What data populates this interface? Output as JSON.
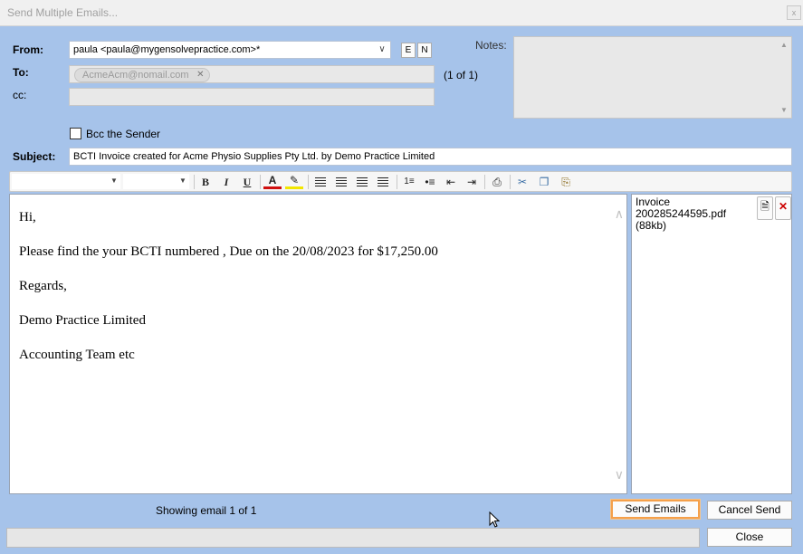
{
  "window": {
    "title": "Send Multiple Emails...",
    "close_glyph": "x"
  },
  "form": {
    "from_label": "From:",
    "from_value": "paula <paula@mygensolvepractice.com>*",
    "e_button": "E",
    "n_button": "N",
    "to_label": "To:",
    "to_chip": "AcmeAcm@nomail.com",
    "to_count": "(1 of 1)",
    "cc_label": "cc:",
    "cc_value": "",
    "notes_label": "Notes:",
    "notes_value": "",
    "bcc_label": "Bcc the Sender",
    "bcc_checked": false,
    "subject_label": "Subject:",
    "subject_value": "BCTI Invoice created for  Acme Physio Supplies Pty Ltd. by  Demo Practice Limited"
  },
  "toolbar": {
    "font_value": "",
    "size_value": "",
    "bold": "B",
    "italic": "I",
    "underline": "U",
    "font_color_glyph": "A",
    "icons": [
      "bold-icon",
      "italic-icon",
      "underline-icon",
      "font-color-icon",
      "highlight-icon",
      "align-left-icon",
      "align-center-icon",
      "align-right-icon",
      "justify-icon",
      "numbered-list-icon",
      "bullet-list-icon",
      "outdent-icon",
      "indent-icon",
      "print-icon",
      "cut-icon",
      "copy-icon",
      "paste-icon"
    ]
  },
  "editor": {
    "lines": [
      "Hi,",
      "Please find the your BCTI numbered , Due on the 20/08/2023 for $17,250.00",
      "Regards,",
      "Demo Practice Limited",
      "Accounting Team etc"
    ]
  },
  "attachments": [
    {
      "name": "Invoice 200285244595.pdf (88kb)"
    }
  ],
  "footer": {
    "showing": "Showing email   1 of 1",
    "send_button": "Send Emails",
    "cancel_button": "Cancel Send",
    "close_button": "Close"
  },
  "colors": {
    "background": "#a6c3ea",
    "accent": "#f5a04a",
    "delete": "#cc0000"
  }
}
